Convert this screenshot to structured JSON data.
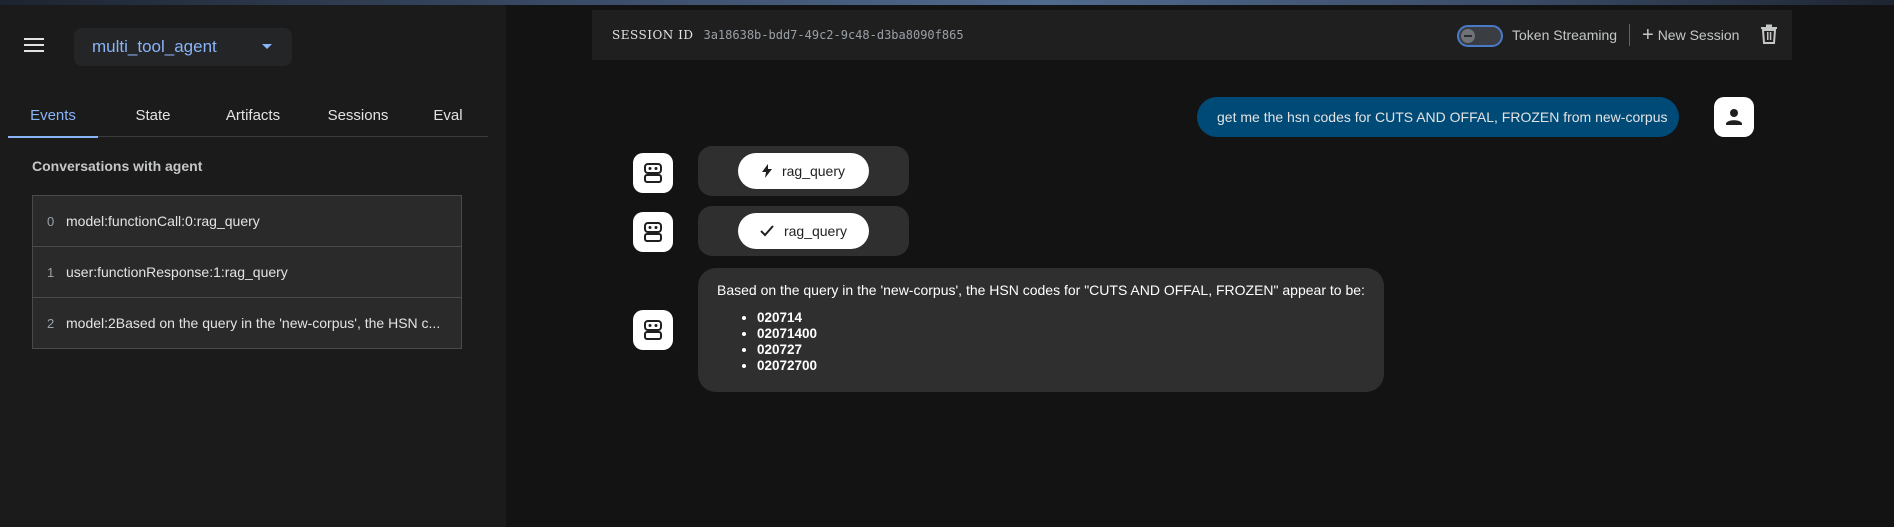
{
  "header": {
    "agent_name": "multi_tool_agent"
  },
  "sidebar": {
    "tabs": [
      {
        "label": "Events",
        "active": true
      },
      {
        "label": "State",
        "active": false
      },
      {
        "label": "Artifacts",
        "active": false
      },
      {
        "label": "Sessions",
        "active": false
      },
      {
        "label": "Eval",
        "active": false
      }
    ],
    "conversations_title": "Conversations with agent",
    "events": [
      {
        "index": "0",
        "text": "model:functionCall:0:rag_query"
      },
      {
        "index": "1",
        "text": "user:functionResponse:1:rag_query"
      },
      {
        "index": "2",
        "text": "model:2Based on the query in the 'new-corpus', the HSN c..."
      }
    ]
  },
  "session_bar": {
    "label": "SESSION ID",
    "id": "3a18638b-bdd7-49c2-9c48-d3ba8090f865",
    "token_streaming_label": "Token Streaming",
    "token_streaming_on": false,
    "new_session_label": "New Session"
  },
  "chat": {
    "user_message": "get me the hsn codes for CUTS AND OFFAL, FROZEN from new-corpus",
    "function_call_chip": "rag_query",
    "function_response_chip": "rag_query",
    "answer_intro": "Based on the query in the 'new-corpus', the HSN codes for \"CUTS AND OFFAL, FROZEN\" appear to be:",
    "answer_items": [
      "020714",
      "02071400",
      "020727",
      "02072700"
    ]
  },
  "colors": {
    "accent": "#8ab4f8",
    "user_bubble": "#004a77",
    "sidebar_bg": "#1b1b1c",
    "main_bg": "#131314"
  }
}
